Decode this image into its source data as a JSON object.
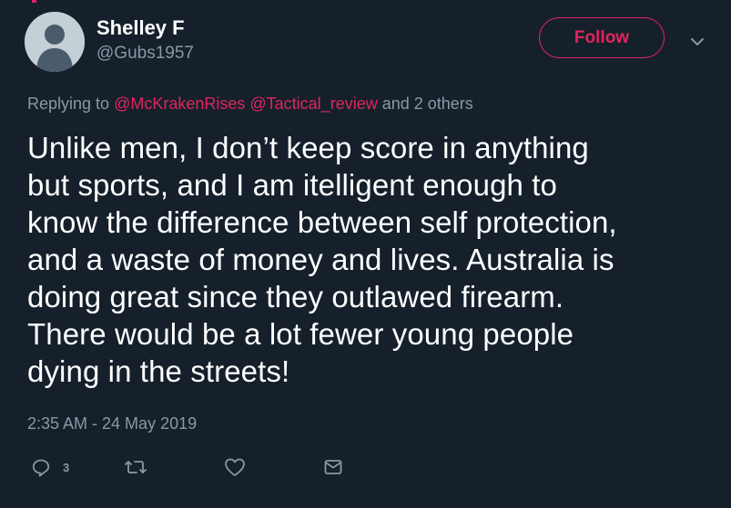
{
  "user": {
    "display_name": "Shelley F",
    "handle": "@Gubs1957"
  },
  "header": {
    "follow_label": "Follow"
  },
  "replying": {
    "prefix": "Replying to ",
    "mention_1": "@McKrakenRises",
    "mention_2": "@Tactical_review",
    "suffix": " and 2 others"
  },
  "tweet": {
    "text": "Unlike men, I don’t keep score in anything\nbut sports, and I am itelligent enough to\nknow the difference between self protection,\nand a waste of money and lives.  Australia is\ndoing great since they outlawed firearm.\nThere would be a lot fewer young people\ndying in the streets!",
    "timestamp": "2:35 AM - 24 May 2019"
  },
  "actions": {
    "reply_count": "3",
    "icons": [
      "reply-icon",
      "retweet-icon",
      "like-icon",
      "direct-message-icon"
    ]
  },
  "colors": {
    "background": "#15202b",
    "accent": "#e0245e",
    "secondary_text": "#8899a6",
    "primary_text": "#ffffff"
  }
}
